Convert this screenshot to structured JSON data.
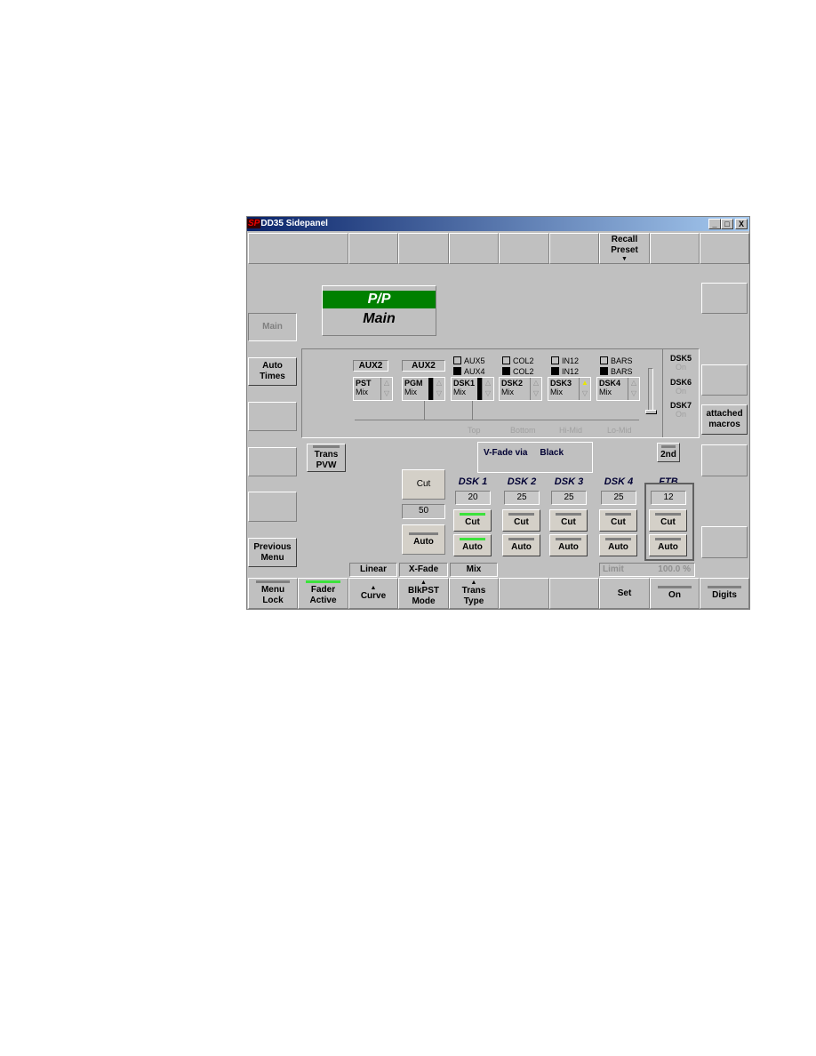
{
  "window": {
    "logo": "SP",
    "title": "DD35 Sidepanel",
    "min": "_",
    "max": "□",
    "close": "X"
  },
  "top_row": [
    "",
    "",
    "",
    "",
    "",
    "",
    "Recall Preset",
    ""
  ],
  "status": {
    "line1": "P/P",
    "line2": "Main",
    "green": "#008000"
  },
  "left": {
    "main": "Main",
    "auto_times": "Auto Times",
    "previous_menu": "Previous Menu"
  },
  "right": {
    "attached_macros": "attached macros"
  },
  "dsk_panel": {
    "aux": [
      "AUX2",
      "AUX2"
    ],
    "check_rows": [
      [
        {
          "label": "AUX5",
          "checked": false
        },
        {
          "label": "COL2",
          "checked": false
        },
        {
          "label": "IN12",
          "checked": false
        },
        {
          "label": "BARS",
          "checked": false
        }
      ],
      [
        {
          "label": "AUX4",
          "checked": true
        },
        {
          "label": "COL2",
          "checked": true
        },
        {
          "label": "IN12",
          "checked": true
        },
        {
          "label": "BARS",
          "checked": true
        }
      ]
    ],
    "selectors": [
      {
        "name": "PST",
        "mode": "Mix"
      },
      {
        "name": "PGM",
        "mode": "Mix"
      },
      {
        "name": "DSK1",
        "mode": "Mix"
      },
      {
        "name": "DSK2",
        "mode": "Mix"
      },
      {
        "name": "DSK3",
        "mode": "Mix"
      },
      {
        "name": "DSK4",
        "mode": "Mix"
      }
    ],
    "levels": [
      "Top",
      "Bottom",
      "Hi-Mid",
      "Lo-Mid"
    ],
    "dsk_extra": [
      {
        "name": "DSK5",
        "state": "On"
      },
      {
        "name": "DSK6",
        "state": "On"
      },
      {
        "name": "DSK7",
        "state": "On"
      }
    ]
  },
  "trans_pvw": "Trans PVW",
  "vfade": {
    "label": "V-Fade via",
    "value": "Black"
  },
  "second": "2nd",
  "main_trans": {
    "cut": "Cut",
    "rate": "50",
    "auto": "Auto"
  },
  "keyers": [
    {
      "name": "DSK 1",
      "rate": "20",
      "cut": "Cut",
      "auto": "Auto",
      "active": true
    },
    {
      "name": "DSK 2",
      "rate": "25",
      "cut": "Cut",
      "auto": "Auto",
      "active": false
    },
    {
      "name": "DSK 3",
      "rate": "25",
      "cut": "Cut",
      "auto": "Auto",
      "active": false
    },
    {
      "name": "DSK 4",
      "rate": "25",
      "cut": "Cut",
      "auto": "Auto",
      "active": false
    },
    {
      "name": "FTB",
      "rate": "12",
      "cut": "Cut",
      "auto": "Auto",
      "active": false
    }
  ],
  "sub_values": {
    "curve": "Linear",
    "mode": "X-Fade",
    "type": "Mix"
  },
  "limit": {
    "label": "Limit",
    "value": "100.0 %"
  },
  "bottom_row": {
    "menu_lock": "Menu Lock",
    "fader_active": "Fader Active",
    "curve": "Curve",
    "blkpst_mode": "BlkPST Mode",
    "trans_type": "Trans Type",
    "set": "Set",
    "on": "On",
    "digits": "Digits"
  }
}
